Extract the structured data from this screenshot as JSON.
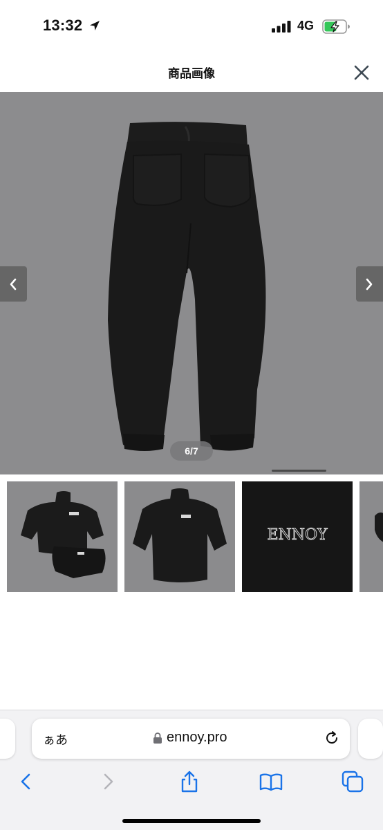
{
  "status_bar": {
    "time": "13:32",
    "network": "4G"
  },
  "header": {
    "title": "商品画像"
  },
  "viewer": {
    "counter": "6/7",
    "current_index": 6,
    "total": 7
  },
  "thumbnails": [
    {
      "name": "thumb-set",
      "logo": "ENNOY"
    },
    {
      "name": "thumb-sweatshirt",
      "logo": "ENNOY"
    },
    {
      "name": "thumb-logo-closeup",
      "logo": "ENNOY"
    },
    {
      "name": "thumb-partial"
    }
  ],
  "browser": {
    "aa_label": "ぁあ",
    "url": "ennoy.pro"
  },
  "colors": {
    "photo_bg": "#8c8c8e",
    "garment": "#1a1a1a",
    "accent_blue": "#1a73e8",
    "battery_green": "#34c759"
  }
}
